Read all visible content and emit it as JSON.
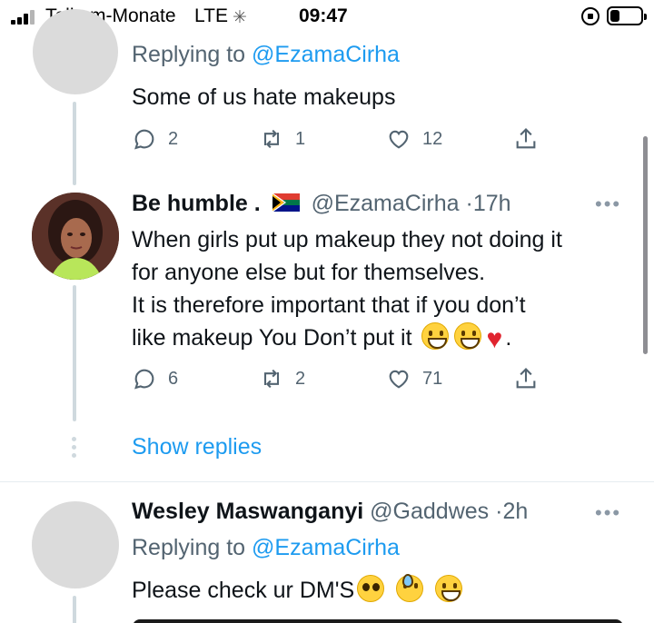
{
  "status_bar": {
    "carrier": "Telkom-Monate",
    "network": "LTE",
    "time": "09:47",
    "battery_level": 0.3
  },
  "tweets": [
    {
      "replying_prefix": "Replying to ",
      "replying_handle": "@EzamaCirha",
      "text": [
        "Some of us hate makeups"
      ],
      "replies": "2",
      "retweets": "1",
      "likes": "12"
    },
    {
      "name": "Be humble .",
      "handle": "@EzamaCirha",
      "time": "17h",
      "text": [
        "When girls put up makeup they not doing it",
        "for anyone else but for themselves.",
        "It is therefore important that if you don’t",
        "like makeup You Don’t put it"
      ],
      "text_tail": ".",
      "replies": "6",
      "retweets": "2",
      "likes": "71",
      "show_replies": "Show replies"
    },
    {
      "name": "Wesley Maswanganyi",
      "handle": "@Gaddwes",
      "time": "2h",
      "replying_prefix": "Replying to ",
      "replying_handle": "@EzamaCirha",
      "text": [
        "Please check ur DM'S"
      ]
    }
  ],
  "colors": {
    "accent": "#1d9bf0",
    "secondary_text": "#536471",
    "thread_line": "#cfd9de"
  }
}
